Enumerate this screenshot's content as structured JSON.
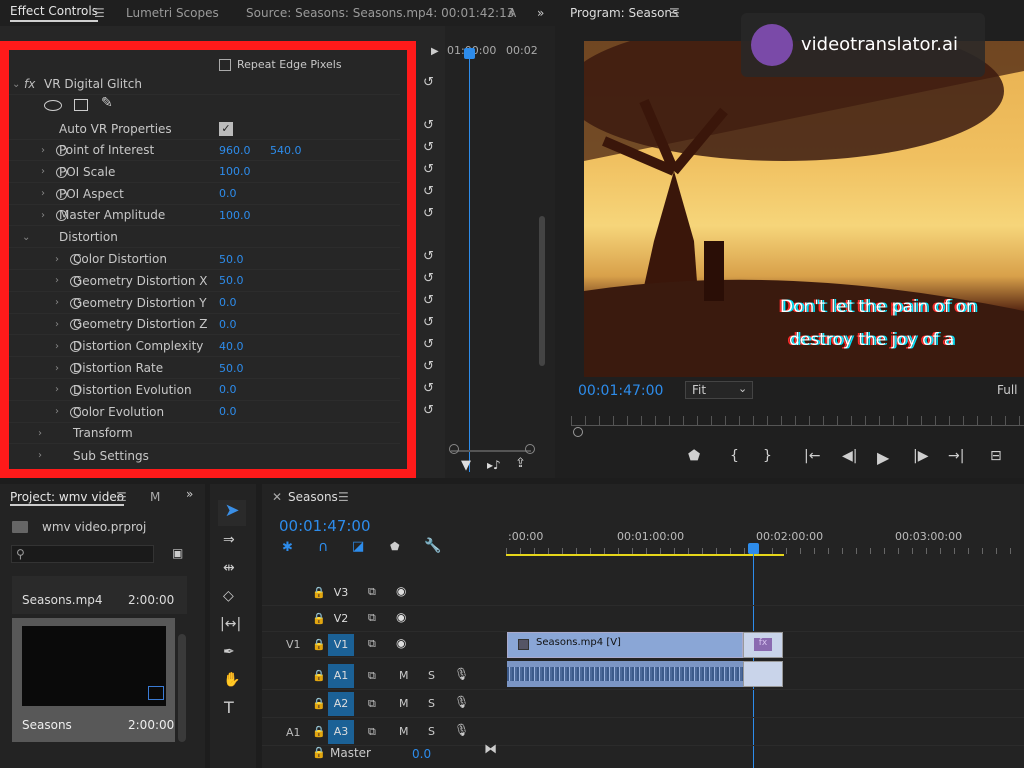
{
  "effect_tabs": {
    "effect_controls": "Effect Controls",
    "lumetri": "Lumetri Scopes",
    "source": "Source: Seasons: Seasons.mp4: 00:01:42:13",
    "extra": "A"
  },
  "timeline_mini": {
    "t1": "01:00:00",
    "t2": "00:02"
  },
  "effect": {
    "top_partial": "Repeat Edge Pixels",
    "name": "VR Digital Glitch",
    "auto_vr": "Auto VR Properties",
    "props": [
      {
        "label": "Point of Interest",
        "v1": "960.0",
        "v2": "540.0"
      },
      {
        "label": "POI Scale",
        "v1": "100.0"
      },
      {
        "label": "POI Aspect",
        "v1": "0.0"
      },
      {
        "label": "Master Amplitude",
        "v1": "100.0"
      }
    ],
    "distortion_group": "Distortion",
    "distortion": [
      {
        "label": "Color Distortion",
        "v1": "50.0"
      },
      {
        "label": "Geometry Distortion X",
        "v1": "50.0"
      },
      {
        "label": "Geometry Distortion Y",
        "v1": "0.0"
      },
      {
        "label": "Geometry Distortion Z",
        "v1": "0.0"
      },
      {
        "label": "Distortion Complexity",
        "v1": "40.0"
      },
      {
        "label": "Distortion Rate",
        "v1": "50.0"
      },
      {
        "label": "Distortion Evolution",
        "v1": "0.0"
      },
      {
        "label": "Color Evolution",
        "v1": "0.0"
      }
    ],
    "transform": "Transform",
    "sub_settings": "Sub Settings"
  },
  "program": {
    "title": "Program: Seasons",
    "timecode": "00:01:47:00",
    "fit": "Fit",
    "full": "Full",
    "subtitle1": "Don't let the pain of on",
    "subtitle2": "destroy the joy of a"
  },
  "watermark": {
    "text": "videotranslator.ai"
  },
  "project": {
    "tab": "Project: wmv video",
    "tab2": "M",
    "file": "wmv video.prproj",
    "items": [
      {
        "name": "Seasons.mp4",
        "duration": "2:00:00"
      },
      {
        "name": "Seasons",
        "duration": "2:00:00"
      }
    ]
  },
  "timeline": {
    "tab": "Seasons",
    "timecode": "00:01:47:00",
    "ruler": [
      ":00:00",
      "00:01:00:00",
      "00:02:00:00",
      "00:03:00:00"
    ],
    "tracks_video": [
      "V3",
      "V2",
      "V1"
    ],
    "tracks_audio": [
      "A1",
      "A2",
      "A3"
    ],
    "source_v1": "V1",
    "source_a1": "A1",
    "mute": "M",
    "solo": "S",
    "master": "Master",
    "master_val": "0.0",
    "clip_video": "Seasons.mp4 [V]",
    "fx_badge": "fx"
  },
  "colors": {
    "accent": "#2d8ceb",
    "highlight_box": "#ff1a1a",
    "clip_video": "#8aa6d6",
    "track_btn": "#1b6196"
  }
}
